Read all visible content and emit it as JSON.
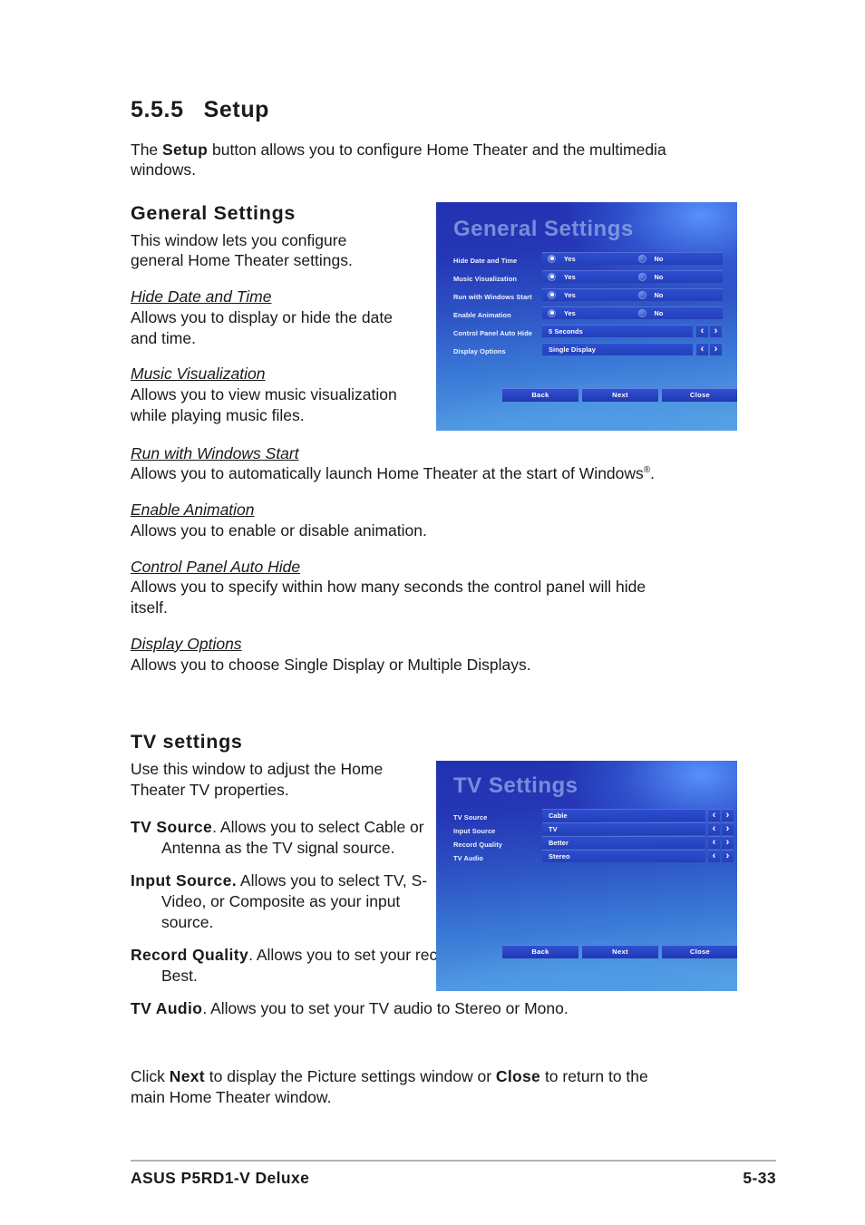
{
  "section": {
    "number": "5.5.5",
    "title": "Setup",
    "intro_pre": "The ",
    "intro_bold": "Setup",
    "intro_post": " button allows you to configure Home Theater and the multimedia windows."
  },
  "general_settings": {
    "heading": "General Settings",
    "intro": "This window lets you configure general Home Theater settings.",
    "terms": [
      {
        "term": "Hide Date and Time",
        "desc": "Allows you to display or hide the date and time."
      },
      {
        "term": "Music Visualization",
        "desc": "Allows you to view music visualization while playing music files."
      },
      {
        "term": "Run with Windows Start",
        "desc_pre": "Allows you to automatically launch Home Theater at the start of Windows",
        "desc_sup": "®",
        "desc_post": "."
      },
      {
        "term": "Enable Animation",
        "desc": "Allows you to enable or disable animation."
      },
      {
        "term": "Control Panel Auto Hide",
        "desc": "Allows you to specify within how many seconds the control panel will hide itself."
      },
      {
        "term": "Display Options",
        "desc": "Allows you to choose Single Display or Multiple Displays."
      }
    ]
  },
  "general_settings_window": {
    "title": "General Settings",
    "radio_rows": [
      {
        "label": "Hide Date and Time",
        "yes": "Yes",
        "no": "No",
        "selected": "yes"
      },
      {
        "label": "Music Visualization",
        "yes": "Yes",
        "no": "No",
        "selected": "yes"
      },
      {
        "label": "Run with Windows Start",
        "yes": "Yes",
        "no": "No",
        "selected": "yes"
      },
      {
        "label": "Enable Animation",
        "yes": "Yes",
        "no": "No",
        "selected": "yes"
      }
    ],
    "select_rows": [
      {
        "label": "Control Panel Auto Hide",
        "value": "5 Seconds"
      },
      {
        "label": "Display Options",
        "value": "Single Display"
      }
    ],
    "arrow_prev": "‹",
    "arrow_next": "›",
    "buttons": [
      "Back",
      "Next",
      "Close"
    ]
  },
  "tv_settings": {
    "heading": "TV settings",
    "intro": "Use this window to adjust the Home Theater TV properties.",
    "items": [
      {
        "term": "TV Source",
        "sep": ". ",
        "desc": "Allows you to select Cable or Antenna as the TV signal source."
      },
      {
        "term": "Input Source.",
        "sep": " ",
        "desc": "Allows you to select TV, S-Video, or Composite as your input source."
      },
      {
        "term": "Record Quality",
        "sep": ". ",
        "desc": "Allows you to set your recording quality to Good, Better, or Best."
      },
      {
        "term": "TV Audio",
        "sep": ". ",
        "desc": "Allows you to set your TV audio to Stereo or Mono."
      }
    ]
  },
  "tv_settings_window": {
    "title": "TV Settings",
    "select_rows": [
      {
        "label": "TV Source",
        "value": "Cable"
      },
      {
        "label": "Input Source",
        "value": "TV"
      },
      {
        "label": "Record Quality",
        "value": "Better"
      },
      {
        "label": "TV Audio",
        "value": "Stereo"
      }
    ],
    "arrow_prev": "‹",
    "arrow_next": "›",
    "buttons": [
      "Back",
      "Next",
      "Close"
    ]
  },
  "closing": {
    "pre": "Click ",
    "bold1": "Next",
    "mid": " to display the Picture settings window or ",
    "bold2": "Close",
    "post": " to return to the main Home Theater  window."
  },
  "footer": {
    "left": "ASUS P5RD1-V Deluxe",
    "right": "5-33"
  }
}
